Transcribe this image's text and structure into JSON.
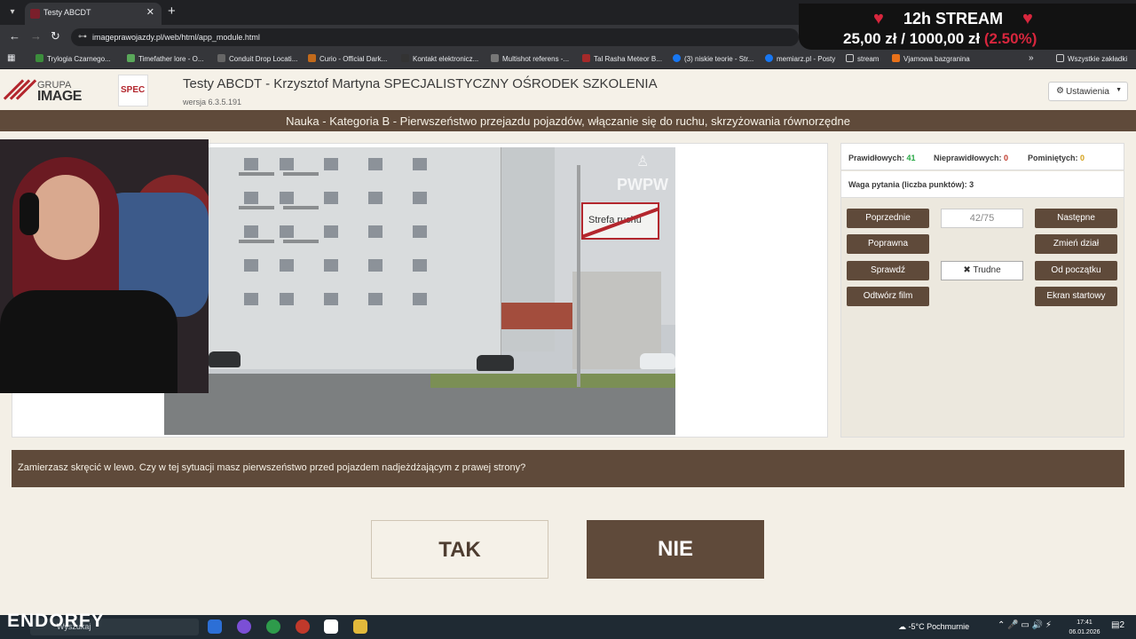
{
  "browser": {
    "tab_title": "Testy ABCDT",
    "url": "imageprawojazdy.pl/web/html/app_module.html",
    "bookmarks": [
      "Trylogia Czarnego...",
      "Timefather lore - O...",
      "Conduit Drop Locati...",
      "Curio - Official Dark...",
      "Kontakt elektronicz...",
      "Multishot referens -...",
      "Tal Rasha Meteor B...",
      "(3) niskie teorie - Str...",
      "memiarz.pl - Posty",
      "stream",
      "Vjamowa bazgranina"
    ],
    "all_bookmarks": "Wszystkie zakładki"
  },
  "stream": {
    "title": "12h STREAM",
    "amount_current": "25,00 zł",
    "separator": "/",
    "amount_goal": "1000,00 zł",
    "percent": "(2.50%)"
  },
  "header": {
    "logo_grupa": "GRUPA",
    "logo_image": "IMAGE",
    "spec_logo": "SPEC",
    "title": "Testy ABCDT - Krzysztof Martyna SPECJALISTYCZNY OŚRODEK SZKOLENIA",
    "version": "wersja 6.3.5.191",
    "settings_label": "Ustawienia"
  },
  "section": {
    "title": "Nauka - Kategoria B - Pierwszeństwo przejazdu pojazdów, włączanie się do ruchu, skrzyżowania równorzędne"
  },
  "media": {
    "sign_text": "Strefa ruchu",
    "watermark": "PWPW"
  },
  "stats": {
    "correct_label": "Prawidłowych:",
    "correct_value": "41",
    "incorrect_label": "Nieprawidłowych:",
    "incorrect_value": "0",
    "skipped_label": "Pominiętych:",
    "skipped_value": "0",
    "weight_label": "Waga pytania (liczba punktów): 3",
    "correct_color": "#27a844",
    "incorrect_color": "#c0392b",
    "skipped_color": "#d4a017"
  },
  "controls": {
    "prev": "Poprzednie",
    "counter": "42/75",
    "next": "Następne",
    "correct": "Poprawna",
    "change_section": "Zmień dział",
    "check": "Sprawdź",
    "hard": "Trudne",
    "from_start": "Od początku",
    "play_video": "Odtwórz film",
    "start_screen": "Ekran startowy"
  },
  "question": {
    "text": "Zamierzasz skręcić w lewo. Czy w tej sytuacji masz pierwszeństwo przed pojazdem nadjeżdżającym z prawej strony?",
    "answer_yes": "TAK",
    "answer_no": "NIE"
  },
  "taskbar": {
    "brand": "ENDORFY",
    "search_placeholder": "Wyszukaj",
    "weather": "-5°C  Pochmurnie",
    "time": "17:41",
    "date": "06.01.2026",
    "notifications": "2"
  },
  "colors": {
    "accent_brown": "#5f4a3a",
    "background": "#f3efe6"
  }
}
